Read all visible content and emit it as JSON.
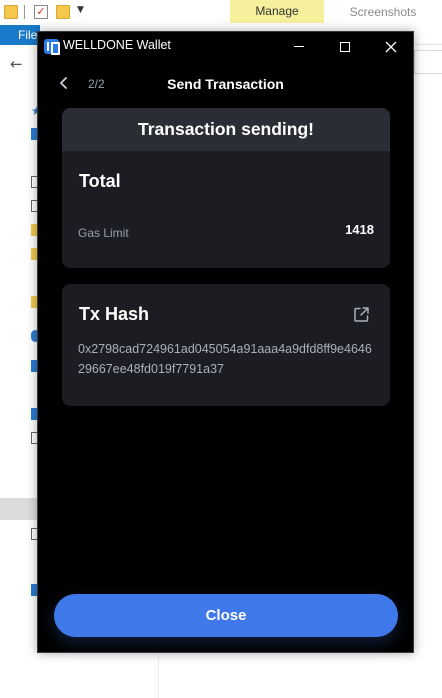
{
  "background_app": {
    "ribbon": {
      "file_tab": "File",
      "manage_tab": "Manage",
      "screenshots_tab": "Screenshots"
    }
  },
  "wallet": {
    "window_title": "WELLDONE Wallet",
    "header": {
      "step": "2/2",
      "title": "Send Transaction"
    },
    "summary": {
      "status": "Transaction sending!",
      "total_label": "Total",
      "gas_limit_label": "Gas Limit",
      "gas_limit_value": "1418"
    },
    "tx": {
      "label": "Tx Hash",
      "hash": "0x2798cad724961ad045054a91aaa4a9dfd8ff9e464629667ee48fd019f7791a37"
    },
    "close_label": "Close"
  },
  "colors": {
    "accent": "#3f78e9",
    "card_bg": "#1b1d22",
    "banner_bg": "#2a2d34",
    "window_bg": "#000000"
  },
  "icons": [
    "back-chevron-icon",
    "external-link-icon",
    "minimize-icon",
    "maximize-icon",
    "close-icon",
    "app-logo-icon"
  ]
}
